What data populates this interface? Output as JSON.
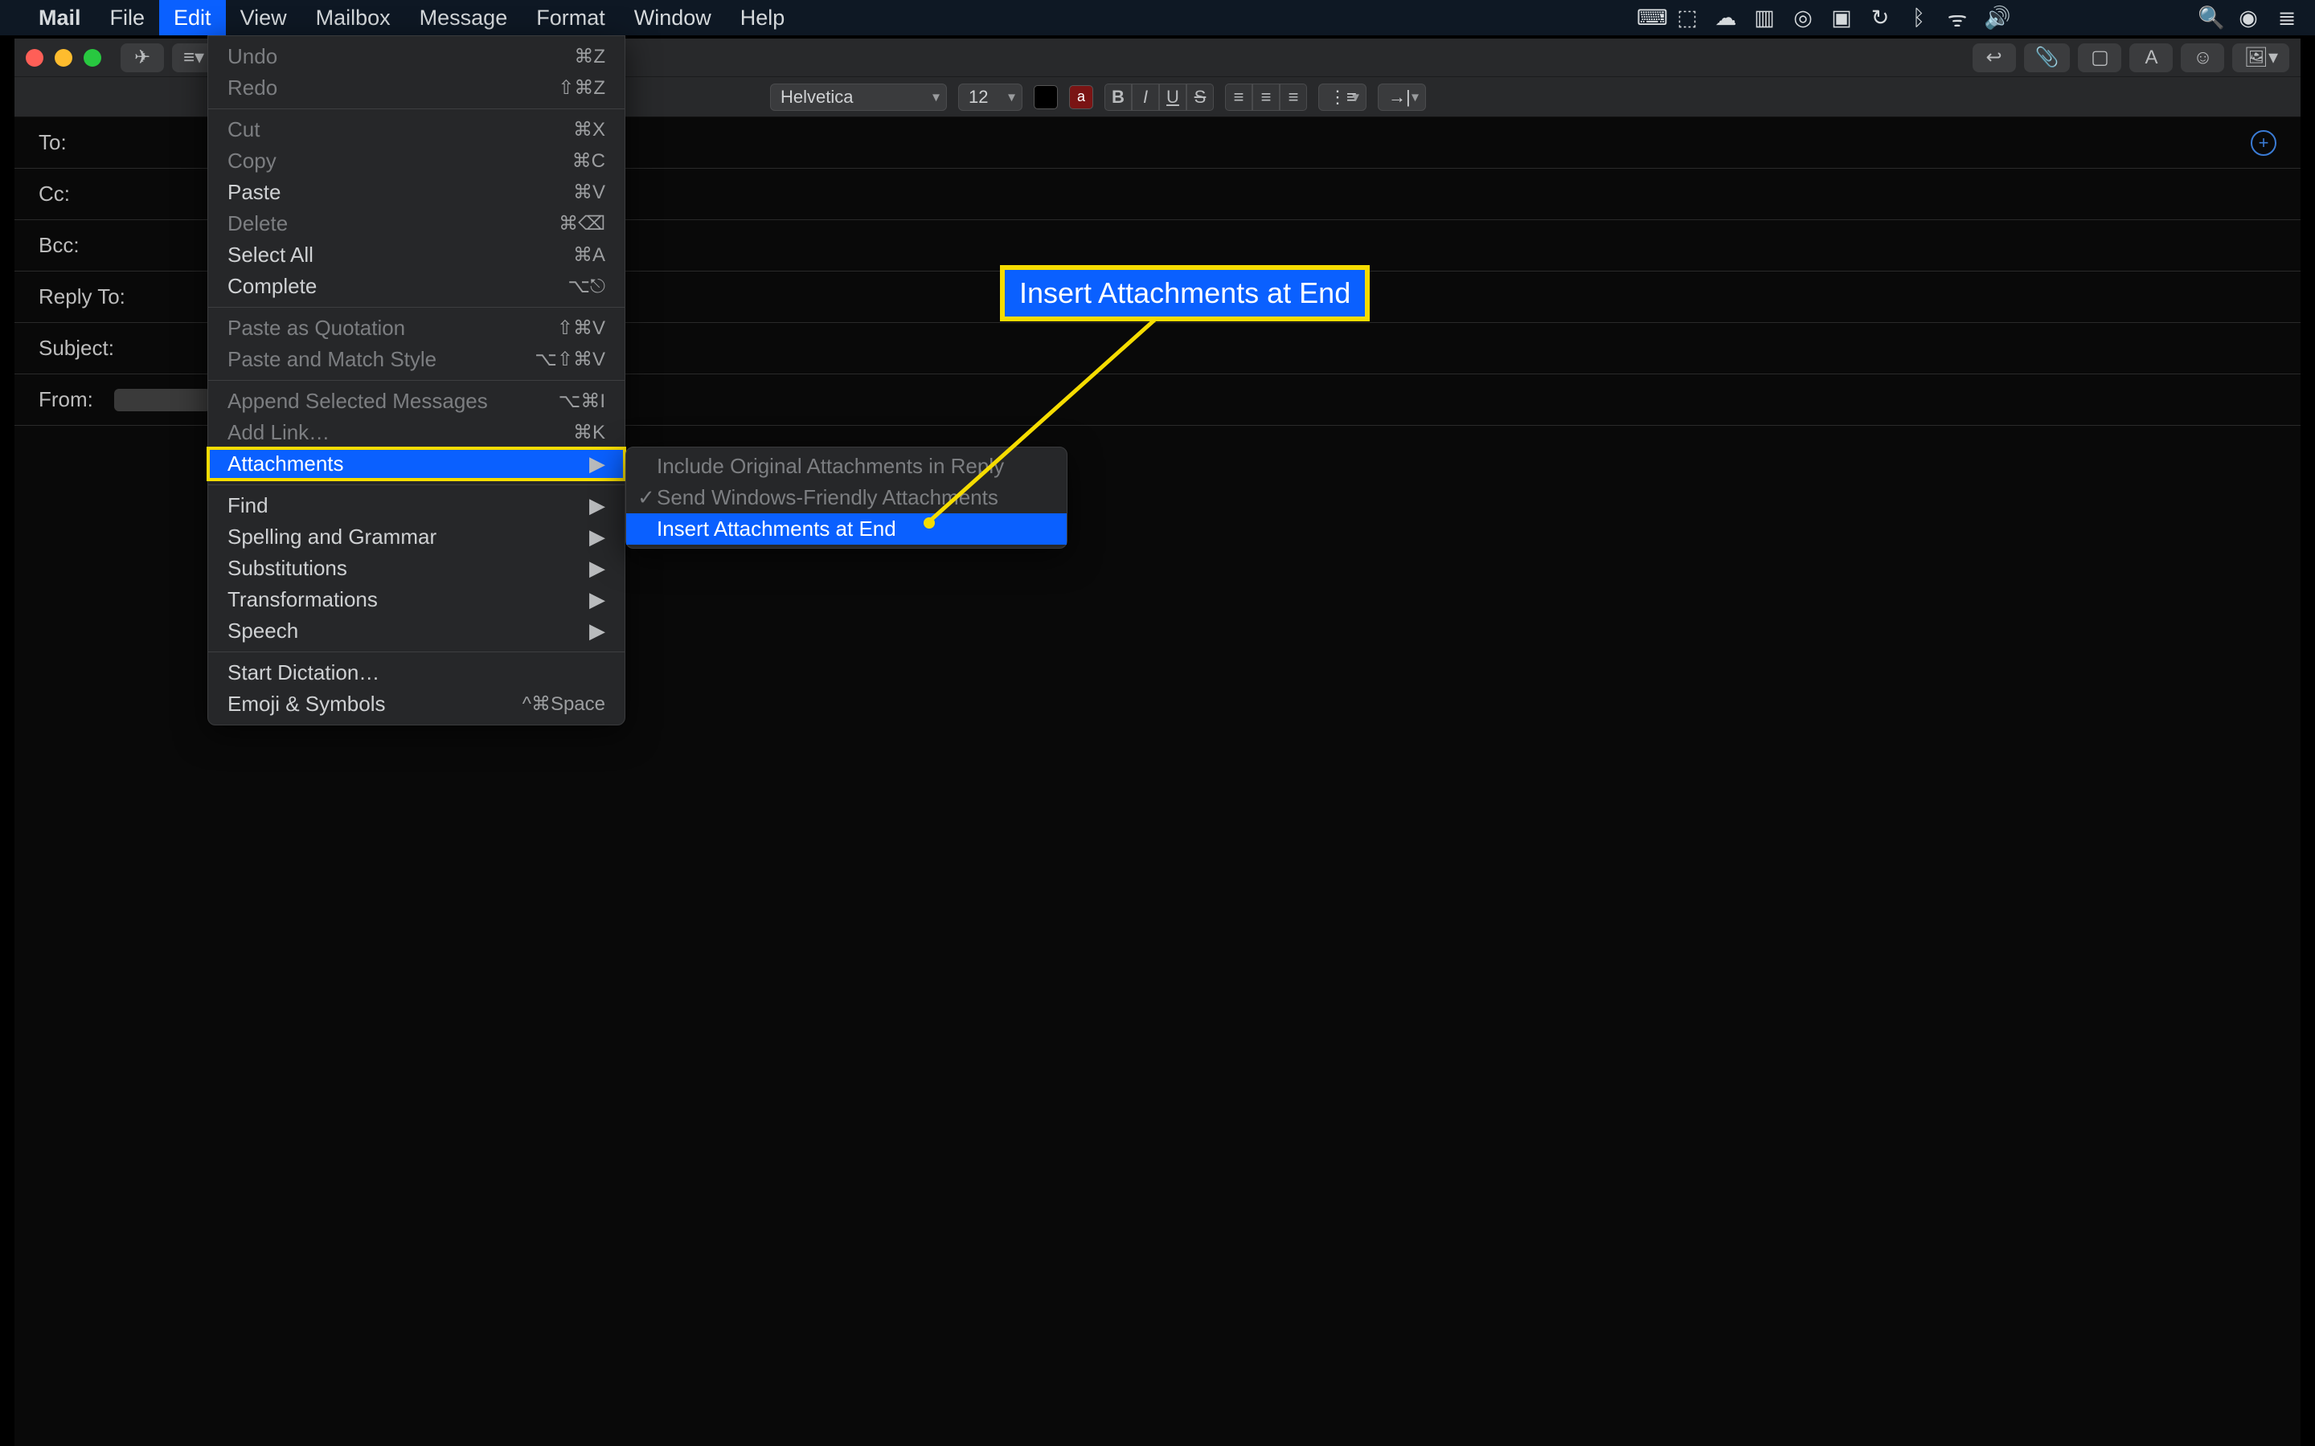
{
  "menubar": {
    "apple": "",
    "app": "Mail",
    "items": [
      "File",
      "Edit",
      "View",
      "Mailbox",
      "Message",
      "Format",
      "Window",
      "Help"
    ],
    "selected_index": 1
  },
  "status_icons": {
    "names": [
      "keyboard-icon",
      "dropbox-icon",
      "cloud-upload-icon",
      "display-icon",
      "creative-cloud-icon",
      "airplay-icon",
      "time-machine-icon",
      "bluetooth-icon",
      "wifi-icon",
      "volume-icon"
    ],
    "glyphs": [
      "⌨︎",
      "⬚",
      "☁︎",
      "▥",
      "◎",
      "▣",
      "↻",
      "ᛒ",
      "ᯤ",
      "🔊"
    ],
    "right_side": [
      "search-icon",
      "siri-icon",
      "control-center-icon"
    ],
    "right_glyphs": [
      "🔍",
      "◉",
      "≣"
    ]
  },
  "compose": {
    "toolbar": {
      "send": "✈︎",
      "reply": "↩︎",
      "attach": "📎",
      "photo": "▢",
      "font": "A",
      "emoji": "☺",
      "dropdown": "▾"
    },
    "formatbar": {
      "font": "Helvetica",
      "size": "12"
    },
    "fields": {
      "to": "To:",
      "cc": "Cc:",
      "bcc": "Bcc:",
      "reply_to": "Reply To:",
      "subject": "Subject:",
      "from": "From:"
    }
  },
  "edit_menu": {
    "items": [
      {
        "label": "Undo",
        "shortcut": "⌘Z",
        "disabled": true
      },
      {
        "label": "Redo",
        "shortcut": "⇧⌘Z",
        "disabled": true
      },
      {
        "sep": true
      },
      {
        "label": "Cut",
        "shortcut": "⌘X",
        "disabled": true
      },
      {
        "label": "Copy",
        "shortcut": "⌘C",
        "disabled": true
      },
      {
        "label": "Paste",
        "shortcut": "⌘V"
      },
      {
        "label": "Delete",
        "shortcut": "⌘⌫",
        "disabled": true
      },
      {
        "label": "Select All",
        "shortcut": "⌘A"
      },
      {
        "label": "Complete",
        "shortcut": "⌥⎋"
      },
      {
        "sep": true
      },
      {
        "label": "Paste as Quotation",
        "shortcut": "⇧⌘V",
        "disabled": true
      },
      {
        "label": "Paste and Match Style",
        "shortcut": "⌥⇧⌘V",
        "disabled": true
      },
      {
        "sep": true
      },
      {
        "label": "Append Selected Messages",
        "shortcut": "⌥⌘I",
        "disabled": true
      },
      {
        "label": "Add Link…",
        "shortcut": "⌘K",
        "disabled": true
      },
      {
        "label": "Attachments",
        "submenu": true,
        "selected": true,
        "highlight": true
      },
      {
        "sep": true
      },
      {
        "label": "Find",
        "submenu": true
      },
      {
        "label": "Spelling and Grammar",
        "submenu": true
      },
      {
        "label": "Substitutions",
        "submenu": true
      },
      {
        "label": "Transformations",
        "submenu": true
      },
      {
        "label": "Speech",
        "submenu": true
      },
      {
        "sep": true
      },
      {
        "label": "Start Dictation…"
      },
      {
        "label": "Emoji & Symbols",
        "shortcut": "^⌘Space"
      }
    ]
  },
  "attachments_submenu": {
    "items": [
      {
        "label": "Include Original Attachments in Reply",
        "disabled": true
      },
      {
        "label": "Send Windows-Friendly Attachments",
        "checked": true,
        "disabled": true
      },
      {
        "label": "Insert Attachments at End",
        "selected": true
      }
    ]
  },
  "callout": {
    "label": "Insert Attachments at End"
  }
}
